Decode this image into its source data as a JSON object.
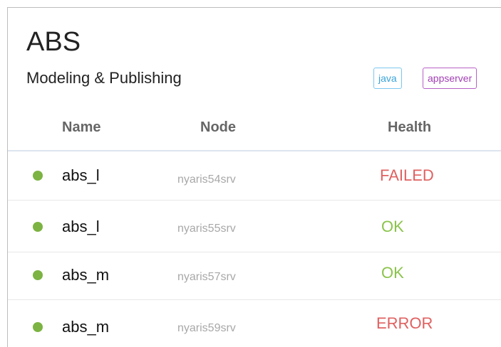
{
  "service": {
    "title": "ABS",
    "subtitle": "Modeling & Publishing"
  },
  "tags": [
    {
      "label": "java",
      "color": "#3aa3d8"
    },
    {
      "label": "appserver",
      "color": "#a23fb5"
    }
  ],
  "table": {
    "columns": [
      "Name",
      "Node",
      "Health"
    ],
    "rows": [
      {
        "name": "abs_l",
        "node": "nyaris54srv",
        "health": "FAILED",
        "status_color": "#7cb342"
      },
      {
        "name": "abs_l",
        "node": "nyaris55srv",
        "health": "OK",
        "status_color": "#7cb342"
      },
      {
        "name": "abs_m",
        "node": "nyaris57srv",
        "health": "OK",
        "status_color": "#7cb342"
      },
      {
        "name": "abs_m",
        "node": "nyaris59srv",
        "health": "ERROR",
        "status_color": "#7cb342"
      }
    ]
  },
  "colors": {
    "failed": "#e06060",
    "ok": "#8bc34a",
    "status_dot": "#7cb342"
  }
}
